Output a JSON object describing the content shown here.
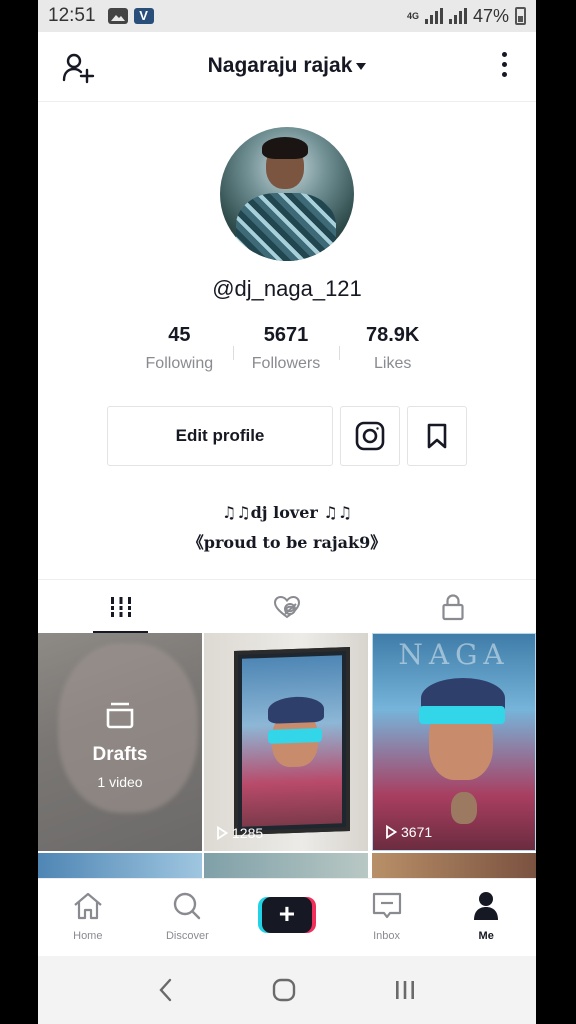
{
  "status_bar": {
    "time": "12:51",
    "network": "4G",
    "battery": "47%"
  },
  "header": {
    "title": "Nagaraju rajak"
  },
  "profile": {
    "username": "@dj_naga_121",
    "stats": [
      {
        "value": "45",
        "label": "Following"
      },
      {
        "value": "5671",
        "label": "Followers"
      },
      {
        "value": "78.9K",
        "label": "Likes"
      }
    ],
    "edit_label": "Edit profile",
    "bio_line1": "♫♫dj lover ♫♫",
    "bio_line2": "《proud to be rajak9》"
  },
  "grid": {
    "drafts_label": "Drafts",
    "drafts_count": "1 video",
    "videos": [
      {
        "views": "1285",
        "overlay_text": "NAGA"
      },
      {
        "views": "3671",
        "overlay_text": "NAGA"
      }
    ]
  },
  "bottom_nav": {
    "items": [
      {
        "label": "Home",
        "icon": "home-icon"
      },
      {
        "label": "Discover",
        "icon": "search-icon"
      },
      {
        "label": "",
        "icon": "plus-icon"
      },
      {
        "label": "Inbox",
        "icon": "inbox-icon"
      },
      {
        "label": "Me",
        "icon": "person-icon"
      }
    ]
  },
  "colors": {
    "accent_cyan": "#22d3e6",
    "accent_red": "#f0305a",
    "text": "#161823",
    "muted": "#8a8b91"
  }
}
